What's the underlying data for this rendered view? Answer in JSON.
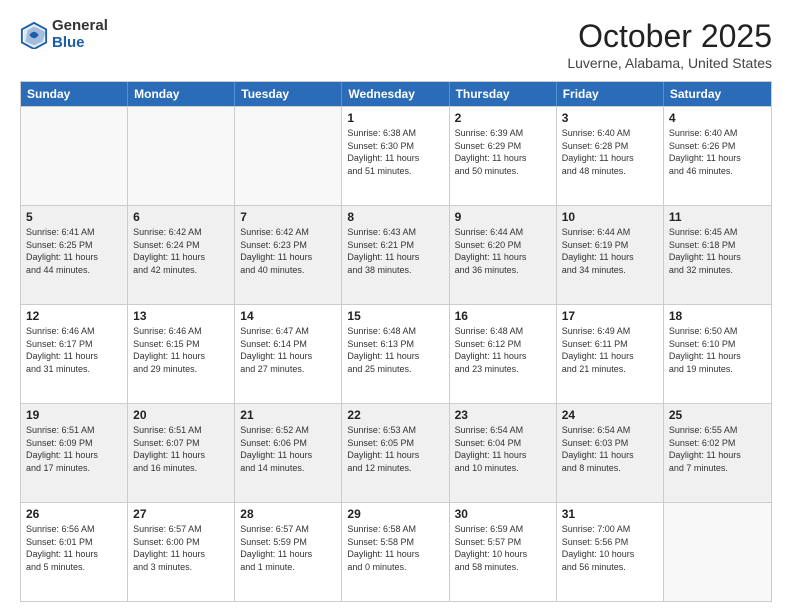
{
  "logo": {
    "general": "General",
    "blue": "Blue"
  },
  "header": {
    "month": "October 2025",
    "location": "Luverne, Alabama, United States"
  },
  "days": [
    "Sunday",
    "Monday",
    "Tuesday",
    "Wednesday",
    "Thursday",
    "Friday",
    "Saturday"
  ],
  "rows": [
    [
      {
        "day": "",
        "lines": [],
        "empty": true
      },
      {
        "day": "",
        "lines": [],
        "empty": true
      },
      {
        "day": "",
        "lines": [],
        "empty": true
      },
      {
        "day": "1",
        "lines": [
          "Sunrise: 6:38 AM",
          "Sunset: 6:30 PM",
          "Daylight: 11 hours",
          "and 51 minutes."
        ]
      },
      {
        "day": "2",
        "lines": [
          "Sunrise: 6:39 AM",
          "Sunset: 6:29 PM",
          "Daylight: 11 hours",
          "and 50 minutes."
        ]
      },
      {
        "day": "3",
        "lines": [
          "Sunrise: 6:40 AM",
          "Sunset: 6:28 PM",
          "Daylight: 11 hours",
          "and 48 minutes."
        ]
      },
      {
        "day": "4",
        "lines": [
          "Sunrise: 6:40 AM",
          "Sunset: 6:26 PM",
          "Daylight: 11 hours",
          "and 46 minutes."
        ]
      }
    ],
    [
      {
        "day": "5",
        "lines": [
          "Sunrise: 6:41 AM",
          "Sunset: 6:25 PM",
          "Daylight: 11 hours",
          "and 44 minutes."
        ],
        "shaded": true
      },
      {
        "day": "6",
        "lines": [
          "Sunrise: 6:42 AM",
          "Sunset: 6:24 PM",
          "Daylight: 11 hours",
          "and 42 minutes."
        ],
        "shaded": true
      },
      {
        "day": "7",
        "lines": [
          "Sunrise: 6:42 AM",
          "Sunset: 6:23 PM",
          "Daylight: 11 hours",
          "and 40 minutes."
        ],
        "shaded": true
      },
      {
        "day": "8",
        "lines": [
          "Sunrise: 6:43 AM",
          "Sunset: 6:21 PM",
          "Daylight: 11 hours",
          "and 38 minutes."
        ],
        "shaded": true
      },
      {
        "day": "9",
        "lines": [
          "Sunrise: 6:44 AM",
          "Sunset: 6:20 PM",
          "Daylight: 11 hours",
          "and 36 minutes."
        ],
        "shaded": true
      },
      {
        "day": "10",
        "lines": [
          "Sunrise: 6:44 AM",
          "Sunset: 6:19 PM",
          "Daylight: 11 hours",
          "and 34 minutes."
        ],
        "shaded": true
      },
      {
        "day": "11",
        "lines": [
          "Sunrise: 6:45 AM",
          "Sunset: 6:18 PM",
          "Daylight: 11 hours",
          "and 32 minutes."
        ],
        "shaded": true
      }
    ],
    [
      {
        "day": "12",
        "lines": [
          "Sunrise: 6:46 AM",
          "Sunset: 6:17 PM",
          "Daylight: 11 hours",
          "and 31 minutes."
        ]
      },
      {
        "day": "13",
        "lines": [
          "Sunrise: 6:46 AM",
          "Sunset: 6:15 PM",
          "Daylight: 11 hours",
          "and 29 minutes."
        ]
      },
      {
        "day": "14",
        "lines": [
          "Sunrise: 6:47 AM",
          "Sunset: 6:14 PM",
          "Daylight: 11 hours",
          "and 27 minutes."
        ]
      },
      {
        "day": "15",
        "lines": [
          "Sunrise: 6:48 AM",
          "Sunset: 6:13 PM",
          "Daylight: 11 hours",
          "and 25 minutes."
        ]
      },
      {
        "day": "16",
        "lines": [
          "Sunrise: 6:48 AM",
          "Sunset: 6:12 PM",
          "Daylight: 11 hours",
          "and 23 minutes."
        ]
      },
      {
        "day": "17",
        "lines": [
          "Sunrise: 6:49 AM",
          "Sunset: 6:11 PM",
          "Daylight: 11 hours",
          "and 21 minutes."
        ]
      },
      {
        "day": "18",
        "lines": [
          "Sunrise: 6:50 AM",
          "Sunset: 6:10 PM",
          "Daylight: 11 hours",
          "and 19 minutes."
        ]
      }
    ],
    [
      {
        "day": "19",
        "lines": [
          "Sunrise: 6:51 AM",
          "Sunset: 6:09 PM",
          "Daylight: 11 hours",
          "and 17 minutes."
        ],
        "shaded": true
      },
      {
        "day": "20",
        "lines": [
          "Sunrise: 6:51 AM",
          "Sunset: 6:07 PM",
          "Daylight: 11 hours",
          "and 16 minutes."
        ],
        "shaded": true
      },
      {
        "day": "21",
        "lines": [
          "Sunrise: 6:52 AM",
          "Sunset: 6:06 PM",
          "Daylight: 11 hours",
          "and 14 minutes."
        ],
        "shaded": true
      },
      {
        "day": "22",
        "lines": [
          "Sunrise: 6:53 AM",
          "Sunset: 6:05 PM",
          "Daylight: 11 hours",
          "and 12 minutes."
        ],
        "shaded": true
      },
      {
        "day": "23",
        "lines": [
          "Sunrise: 6:54 AM",
          "Sunset: 6:04 PM",
          "Daylight: 11 hours",
          "and 10 minutes."
        ],
        "shaded": true
      },
      {
        "day": "24",
        "lines": [
          "Sunrise: 6:54 AM",
          "Sunset: 6:03 PM",
          "Daylight: 11 hours",
          "and 8 minutes."
        ],
        "shaded": true
      },
      {
        "day": "25",
        "lines": [
          "Sunrise: 6:55 AM",
          "Sunset: 6:02 PM",
          "Daylight: 11 hours",
          "and 7 minutes."
        ],
        "shaded": true
      }
    ],
    [
      {
        "day": "26",
        "lines": [
          "Sunrise: 6:56 AM",
          "Sunset: 6:01 PM",
          "Daylight: 11 hours",
          "and 5 minutes."
        ]
      },
      {
        "day": "27",
        "lines": [
          "Sunrise: 6:57 AM",
          "Sunset: 6:00 PM",
          "Daylight: 11 hours",
          "and 3 minutes."
        ]
      },
      {
        "day": "28",
        "lines": [
          "Sunrise: 6:57 AM",
          "Sunset: 5:59 PM",
          "Daylight: 11 hours",
          "and 1 minute."
        ]
      },
      {
        "day": "29",
        "lines": [
          "Sunrise: 6:58 AM",
          "Sunset: 5:58 PM",
          "Daylight: 11 hours",
          "and 0 minutes."
        ]
      },
      {
        "day": "30",
        "lines": [
          "Sunrise: 6:59 AM",
          "Sunset: 5:57 PM",
          "Daylight: 10 hours",
          "and 58 minutes."
        ]
      },
      {
        "day": "31",
        "lines": [
          "Sunrise: 7:00 AM",
          "Sunset: 5:56 PM",
          "Daylight: 10 hours",
          "and 56 minutes."
        ]
      },
      {
        "day": "",
        "lines": [],
        "empty": true
      }
    ]
  ]
}
